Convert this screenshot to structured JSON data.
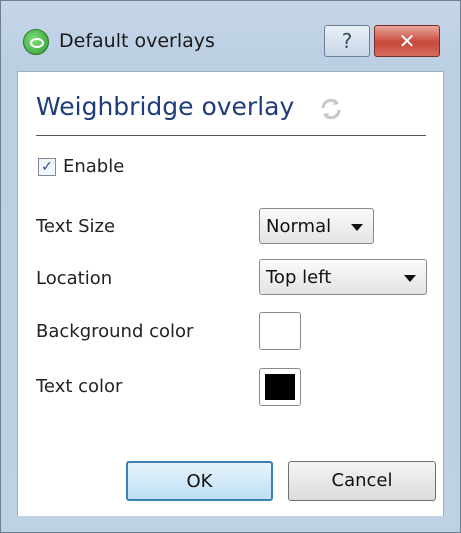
{
  "window": {
    "title": "Default overlays",
    "help_label": "?",
    "close_label": "✕"
  },
  "panel": {
    "heading": "Weighbridge overlay",
    "refresh_icon": "refresh-icon"
  },
  "enable": {
    "label": "Enable",
    "checked": true,
    "check_mark": "✓"
  },
  "text_size": {
    "label": "Text Size",
    "value": "Normal"
  },
  "location": {
    "label": "Location",
    "value": "Top left"
  },
  "background_color": {
    "label": "Background color",
    "color": "#ffffff"
  },
  "text_color": {
    "label": "Text color",
    "color": "#000000"
  },
  "buttons": {
    "ok": "OK",
    "cancel": "Cancel"
  },
  "colors": {
    "heading": "#1f3d7a",
    "title_bar": "#c6d6e8",
    "close_button": "#c8493a"
  }
}
